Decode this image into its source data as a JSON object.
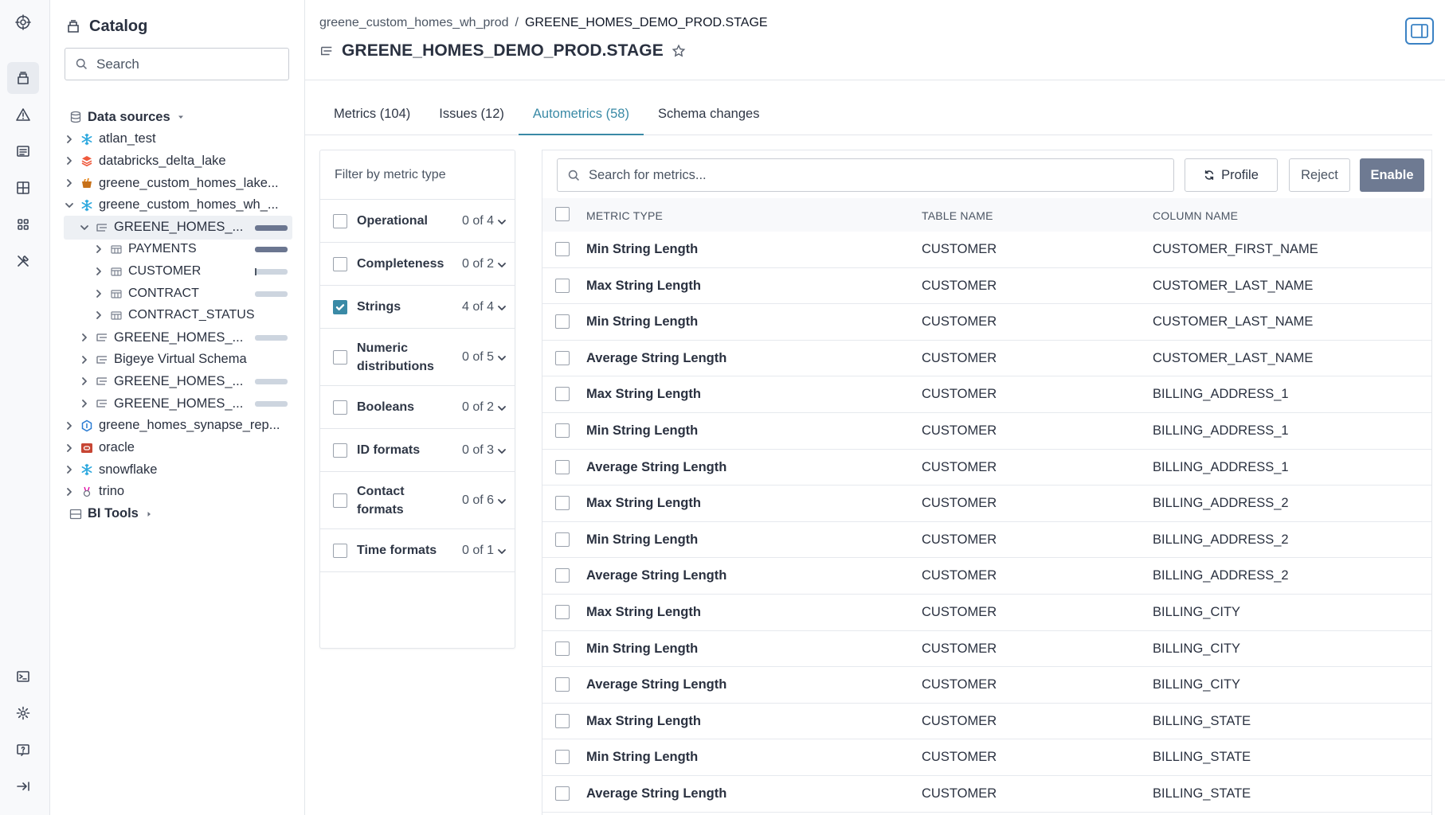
{
  "sidebar": {
    "title": "Catalog",
    "search_placeholder": "Search",
    "tree": [
      {
        "label": "Data sources",
        "level": 0,
        "expander": "caret-down",
        "icon": "database-icon",
        "bold": true
      },
      {
        "label": "atlan_test",
        "level": 0,
        "expander": "chevron-right",
        "icon": "snowflake-icon"
      },
      {
        "label": "databricks_delta_lake",
        "level": 0,
        "expander": "chevron-right",
        "icon": "databricks-icon"
      },
      {
        "label": "greene_custom_homes_lake...",
        "level": 0,
        "expander": "chevron-right",
        "icon": "bucket-icon"
      },
      {
        "label": "greene_custom_homes_wh_...",
        "level": 0,
        "expander": "chevron-down",
        "icon": "snowflake-icon"
      },
      {
        "label": "GREENE_HOMES_...",
        "level": 1,
        "expander": "chevron-down",
        "icon": "schema-icon",
        "selected": true,
        "bar": "dark"
      },
      {
        "label": "PAYMENTS",
        "level": 2,
        "expander": "chevron-right",
        "icon": "table-icon",
        "bar": "dark"
      },
      {
        "label": "CUSTOMER",
        "level": 2,
        "expander": "chevron-right",
        "icon": "table-icon",
        "bar": "tick"
      },
      {
        "label": "CONTRACT",
        "level": 2,
        "expander": "chevron-right",
        "icon": "table-icon",
        "bar": "light"
      },
      {
        "label": "CONTRACT_STATUS",
        "level": 2,
        "expander": "chevron-right",
        "icon": "table-icon"
      },
      {
        "label": "GREENE_HOMES_...",
        "level": 1,
        "expander": "chevron-right",
        "icon": "schema-icon",
        "bar": "light"
      },
      {
        "label": "Bigeye Virtual Schema",
        "level": 1,
        "expander": "chevron-right",
        "icon": "schema-icon"
      },
      {
        "label": "GREENE_HOMES_...",
        "level": 1,
        "expander": "chevron-right",
        "icon": "schema-icon",
        "bar": "light"
      },
      {
        "label": "GREENE_HOMES_...",
        "level": 1,
        "expander": "chevron-right",
        "icon": "schema-icon",
        "bar": "light"
      },
      {
        "label": "greene_homes_synapse_rep...",
        "level": 0,
        "expander": "chevron-right",
        "icon": "synapse-icon"
      },
      {
        "label": "oracle",
        "level": 0,
        "expander": "chevron-right",
        "icon": "oracle-icon"
      },
      {
        "label": "snowflake",
        "level": 0,
        "expander": "chevron-right",
        "icon": "snowflake-icon"
      },
      {
        "label": "trino",
        "level": 0,
        "expander": "chevron-right",
        "icon": "trino-icon"
      },
      {
        "label": "BI Tools",
        "level": 0,
        "expander": "caret-right",
        "icon": "bi-tools-icon",
        "bold": true
      }
    ]
  },
  "header": {
    "breadcrumb_parent": "greene_custom_homes_wh_prod",
    "breadcrumb_sep": "/",
    "breadcrumb_current": "GREENE_HOMES_DEMO_PROD.STAGE",
    "title": "GREENE_HOMES_DEMO_PROD.STAGE"
  },
  "tabs": [
    {
      "label": "Metrics (104)",
      "active": false
    },
    {
      "label": "Issues (12)",
      "active": false
    },
    {
      "label": "Autometrics (58)",
      "active": true
    },
    {
      "label": "Schema changes",
      "active": false
    }
  ],
  "filter": {
    "title": "Filter by metric type",
    "groups": [
      {
        "label": "Operational",
        "count": "0 of 4",
        "checked": false
      },
      {
        "label": "Completeness",
        "count": "0 of 2",
        "checked": false
      },
      {
        "label": "Strings",
        "count": "4 of 4",
        "checked": true
      },
      {
        "label": "Numeric distributions",
        "count": "0 of 5",
        "checked": false
      },
      {
        "label": "Booleans",
        "count": "0 of 2",
        "checked": false
      },
      {
        "label": "ID formats",
        "count": "0 of 3",
        "checked": false
      },
      {
        "label": "Contact formats",
        "count": "0 of 6",
        "checked": false
      },
      {
        "label": "Time formats",
        "count": "0 of 1",
        "checked": false
      }
    ]
  },
  "metrics": {
    "search_placeholder": "Search for metrics...",
    "profile_label": "Profile",
    "reject_label": "Reject",
    "enable_label": "Enable",
    "columns": [
      "METRIC TYPE",
      "TABLE NAME",
      "COLUMN NAME"
    ],
    "rows": [
      [
        "Min String Length",
        "CUSTOMER",
        "CUSTOMER_FIRST_NAME"
      ],
      [
        "Max String Length",
        "CUSTOMER",
        "CUSTOMER_LAST_NAME"
      ],
      [
        "Min String Length",
        "CUSTOMER",
        "CUSTOMER_LAST_NAME"
      ],
      [
        "Average String Length",
        "CUSTOMER",
        "CUSTOMER_LAST_NAME"
      ],
      [
        "Max String Length",
        "CUSTOMER",
        "BILLING_ADDRESS_1"
      ],
      [
        "Min String Length",
        "CUSTOMER",
        "BILLING_ADDRESS_1"
      ],
      [
        "Average String Length",
        "CUSTOMER",
        "BILLING_ADDRESS_1"
      ],
      [
        "Max String Length",
        "CUSTOMER",
        "BILLING_ADDRESS_2"
      ],
      [
        "Min String Length",
        "CUSTOMER",
        "BILLING_ADDRESS_2"
      ],
      [
        "Average String Length",
        "CUSTOMER",
        "BILLING_ADDRESS_2"
      ],
      [
        "Max String Length",
        "CUSTOMER",
        "BILLING_CITY"
      ],
      [
        "Min String Length",
        "CUSTOMER",
        "BILLING_CITY"
      ],
      [
        "Average String Length",
        "CUSTOMER",
        "BILLING_CITY"
      ],
      [
        "Max String Length",
        "CUSTOMER",
        "BILLING_STATE"
      ],
      [
        "Min String Length",
        "CUSTOMER",
        "BILLING_STATE"
      ],
      [
        "Average String Length",
        "CUSTOMER",
        "BILLING_STATE"
      ]
    ]
  },
  "colors": {
    "accent": "#3a8aa6",
    "enable_button": "#6e7a92",
    "panel_toggle": "#3b82c4"
  }
}
